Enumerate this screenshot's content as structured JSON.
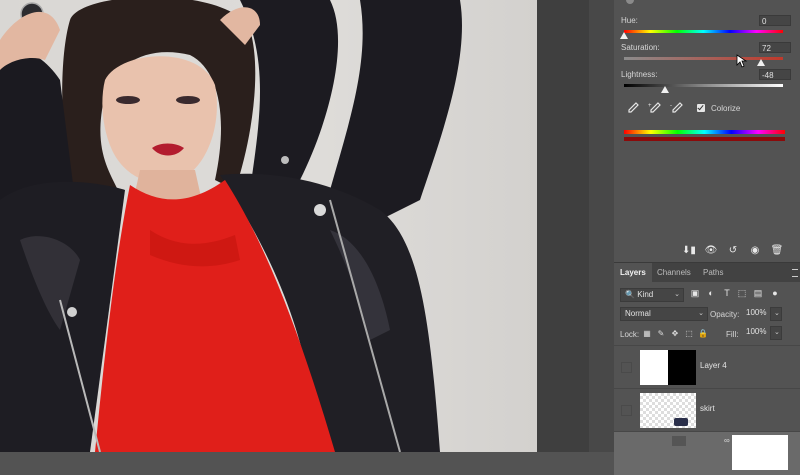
{
  "properties": {
    "hue_label": "Hue:",
    "hue_value": "0",
    "hue_position": 0.0,
    "saturation_label": "Saturation:",
    "saturation_value": "72",
    "saturation_position": 0.86,
    "lightness_label": "Lightness:",
    "lightness_value": "-48",
    "lightness_position": 0.26,
    "colorize_label": "Colorize",
    "colorize_checked": true
  },
  "layers_panel": {
    "tabs": [
      "Layers",
      "Channels",
      "Paths"
    ],
    "filter_kind": "Kind",
    "blend_mode": "Normal",
    "opacity_label": "Opacity:",
    "opacity_value": "100%",
    "lock_label": "Lock:",
    "fill_label": "Fill:",
    "fill_value": "100%",
    "layers": [
      {
        "name": "Layer 4"
      },
      {
        "name": "skirt"
      },
      {
        "name": ""
      }
    ]
  },
  "colors": {
    "panel_bg": "#535353",
    "saturation_track": "#c0392b",
    "result_bar": "#8b0a0a"
  },
  "icons": [
    "eyedropper-icon",
    "eyedropper-plus-icon",
    "eyedropper-minus-icon",
    "clip-to-layer-icon",
    "view-previous-icon",
    "reset-icon",
    "visibility-icon",
    "trash-icon",
    "search-icon",
    "pixel-filter-icon",
    "adjustment-filter-icon",
    "type-filter-icon",
    "shape-filter-icon",
    "smart-object-filter-icon",
    "lock-transparent-icon",
    "lock-paint-icon",
    "lock-position-icon",
    "lock-artboard-icon",
    "lock-all-icon"
  ]
}
